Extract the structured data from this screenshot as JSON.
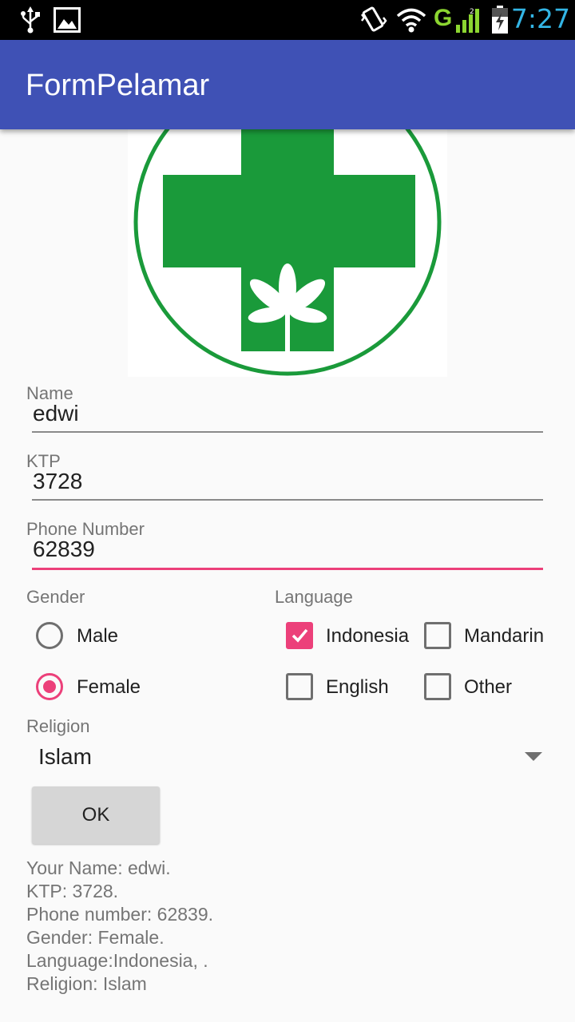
{
  "status_bar": {
    "time": "7:27",
    "network": "G",
    "icons": [
      "usb-icon",
      "image-icon",
      "vibrate-icon",
      "wifi-icon",
      "signal-icon",
      "battery-icon"
    ]
  },
  "app_bar": {
    "title": "FormPelamar"
  },
  "logo": {
    "icon": "green-cross-logo-icon",
    "color": "#1a9a3a"
  },
  "form": {
    "name": {
      "label": "Name",
      "value": "edwi"
    },
    "ktp": {
      "label": "KTP",
      "value": "3728"
    },
    "phone": {
      "label": "Phone Number",
      "value": "62839"
    },
    "gender": {
      "label": "Gender",
      "options": [
        {
          "label": "Male",
          "checked": false
        },
        {
          "label": "Female",
          "checked": true
        }
      ]
    },
    "language": {
      "label": "Language",
      "options": [
        {
          "label": "Indonesia",
          "checked": true
        },
        {
          "label": "Mandarin",
          "checked": false
        },
        {
          "label": "English",
          "checked": false
        },
        {
          "label": "Other",
          "checked": false
        }
      ]
    },
    "religion": {
      "label": "Religion",
      "selected": "Islam"
    },
    "ok_label": "OK"
  },
  "result": {
    "lines": [
      "Your Name: edwi.",
      "KTP: 3728.",
      "Phone number: 62839.",
      "Gender: Female.",
      "Language:Indonesia, .",
      "Religion: Islam"
    ]
  },
  "colors": {
    "primary": "#3f51b5",
    "accent": "#ec407a"
  }
}
